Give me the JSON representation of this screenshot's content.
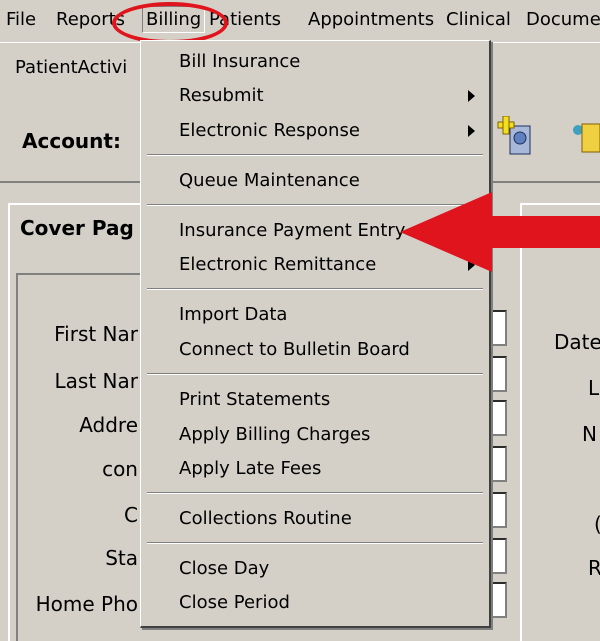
{
  "menubar": {
    "file": "File",
    "reports": "Reports",
    "billing": "Billing",
    "patients": "Patients",
    "appointments": "Appointments",
    "clinical": "Clinical",
    "documents": "Documen"
  },
  "toolbar": {
    "tab_label": "PatientActivi",
    "account_label": "Account:"
  },
  "cover": {
    "title": "Cover Pag",
    "fields": [
      "First Nar",
      "Last Nar",
      "Addre",
      "con",
      "C",
      "Sta",
      "Home Pho"
    ]
  },
  "right": {
    "title": "",
    "fields": [
      "Date",
      "L",
      "N",
      "(",
      "R"
    ]
  },
  "billing_menu": {
    "items": [
      {
        "label": "Bill Insurance",
        "submenu": false
      },
      {
        "label": "Resubmit",
        "submenu": true
      },
      {
        "label": "Electronic Response",
        "submenu": true
      },
      {
        "label": "Queue Maintenance",
        "submenu": false
      },
      {
        "label": "Insurance Payment Entry",
        "submenu": false
      },
      {
        "label": "Electronic Remittance",
        "submenu": true
      },
      {
        "label": "Import Data",
        "submenu": false
      },
      {
        "label": "Connect to Bulletin Board",
        "submenu": false
      },
      {
        "label": "Print Statements",
        "submenu": false
      },
      {
        "label": "Apply Billing Charges",
        "submenu": false
      },
      {
        "label": "Apply Late Fees",
        "submenu": false
      },
      {
        "label": "Collections Routine",
        "submenu": false
      },
      {
        "label": "Close Day",
        "submenu": false
      },
      {
        "label": "Close Period",
        "submenu": false
      }
    ]
  },
  "annotations": {
    "highlight_color": "#e0141c",
    "circle_target": "Billing",
    "arrow_target": "Insurance Payment Entry"
  },
  "icons": [
    "patient-add-icon",
    "patient-info-icon"
  ]
}
